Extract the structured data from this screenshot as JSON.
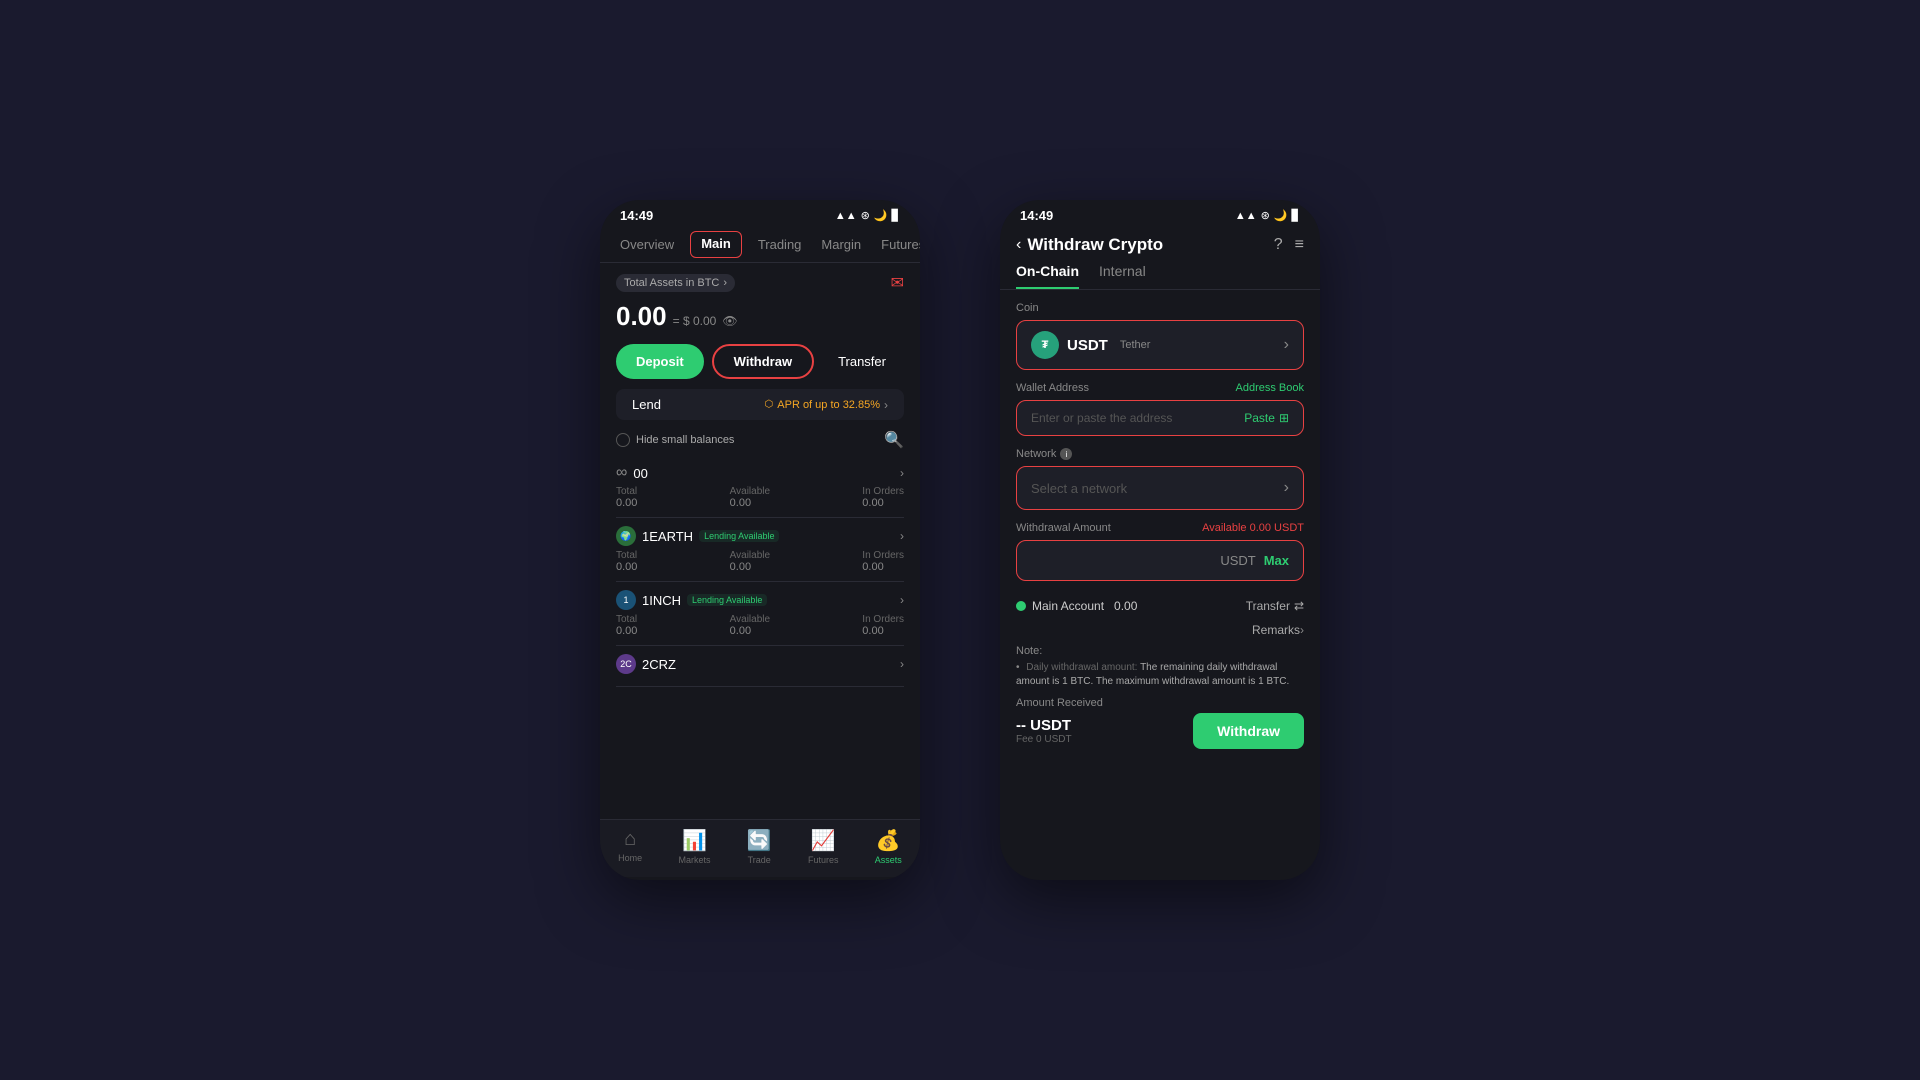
{
  "phone1": {
    "statusBar": {
      "time": "14:49",
      "icons": "▲▲ ⓦ ▊"
    },
    "nav": {
      "tabs": [
        "Overview",
        "Main",
        "Trading",
        "Margin",
        "Futures"
      ],
      "activeTab": "Main"
    },
    "totalAssets": {
      "label": "Total Assets in BTC",
      "mailIcon": "✉"
    },
    "balance": {
      "main": "0.00",
      "usd": "= $ 0.00"
    },
    "buttons": {
      "deposit": "Deposit",
      "withdraw": "Withdraw",
      "transfer": "Transfer"
    },
    "lend": {
      "label": "Lend",
      "apr": "APR of up to 32.85%"
    },
    "filter": {
      "hideSmallBalances": "Hide small balances"
    },
    "assets": [
      {
        "symbol": "∞",
        "name": "00",
        "badge": "",
        "total": "0.00",
        "available": "0.00",
        "inOrders": "0.00"
      },
      {
        "symbol": "1E",
        "name": "1EARTH",
        "badge": "Lending Available",
        "total": "0.00",
        "available": "0.00",
        "inOrders": "0.00"
      },
      {
        "symbol": "1",
        "name": "1INCH",
        "badge": "Lending Available",
        "total": "0.00",
        "available": "0.00",
        "inOrders": "0.00"
      },
      {
        "symbol": "2C",
        "name": "2CRZ",
        "badge": "",
        "total": "",
        "available": "",
        "inOrders": ""
      }
    ],
    "bottomNav": [
      {
        "icon": "🏠",
        "label": "Home",
        "active": false
      },
      {
        "icon": "📊",
        "label": "Markets",
        "active": false
      },
      {
        "icon": "🔄",
        "label": "Trade",
        "active": false
      },
      {
        "icon": "📈",
        "label": "Futures",
        "active": false
      },
      {
        "icon": "💰",
        "label": "Assets",
        "active": true
      }
    ],
    "columnHeaders": {
      "total": "Total",
      "available": "Available",
      "inOrders": "In Orders"
    }
  },
  "phone2": {
    "statusBar": {
      "time": "14:49"
    },
    "header": {
      "backArrow": "‹",
      "title": "Withdraw Crypto",
      "helpIcon": "?",
      "listIcon": "≡"
    },
    "tabs": {
      "onChain": "On-Chain",
      "internal": "Internal"
    },
    "coin": {
      "label": "Coin",
      "name": "USDT",
      "subtitle": "Tether",
      "iconText": "₮"
    },
    "walletAddress": {
      "label": "Wallet Address",
      "addressBookLabel": "Address Book",
      "placeholder": "Enter or paste the address",
      "pasteLabel": "Paste"
    },
    "network": {
      "label": "Network",
      "placeholder": "Select a network"
    },
    "withdrawalAmount": {
      "label": "Withdrawal Amount",
      "available": "Available 0.00 USDT",
      "currency": "USDT",
      "maxLabel": "Max"
    },
    "mainAccount": {
      "label": "Main Account",
      "balance": "0.00",
      "transferLabel": "Transfer"
    },
    "remarks": {
      "label": "Remarks"
    },
    "note": {
      "label": "Note:",
      "bulletText": "Daily withdrawal amount:",
      "noteText": "The remaining daily withdrawal amount is 1  BTC. The maximum withdrawal amount is 1  BTC."
    },
    "amountReceived": {
      "label": "Amount Received",
      "amount": "-- USDT",
      "fee": "Fee 0 USDT"
    },
    "withdrawButton": "Withdraw"
  }
}
